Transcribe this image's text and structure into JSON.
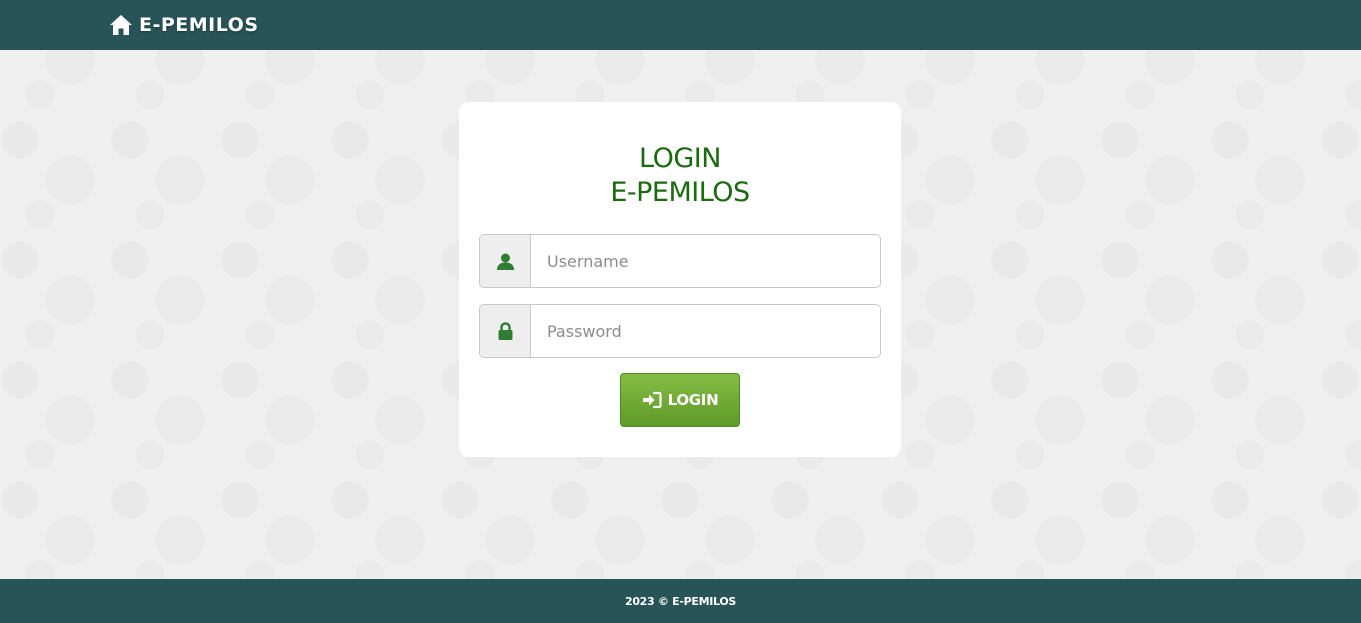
{
  "navbar": {
    "brand_icon": "home-icon",
    "brand_text": "E-PEMILOS",
    "background_color": "#285357"
  },
  "login_card": {
    "title_line1": "LOGIN",
    "title_line2": "E-PEMILOS",
    "title_color": "#1b6a0f",
    "username": {
      "icon": "user-icon",
      "placeholder": "Username",
      "value": ""
    },
    "password": {
      "icon": "lock-icon",
      "placeholder": "Password",
      "value": ""
    },
    "login_button": {
      "icon": "sign-in-icon",
      "label": "LOGIN",
      "color": "#6ea832"
    }
  },
  "footer": {
    "text": "2023 © E-PEMILOS"
  }
}
